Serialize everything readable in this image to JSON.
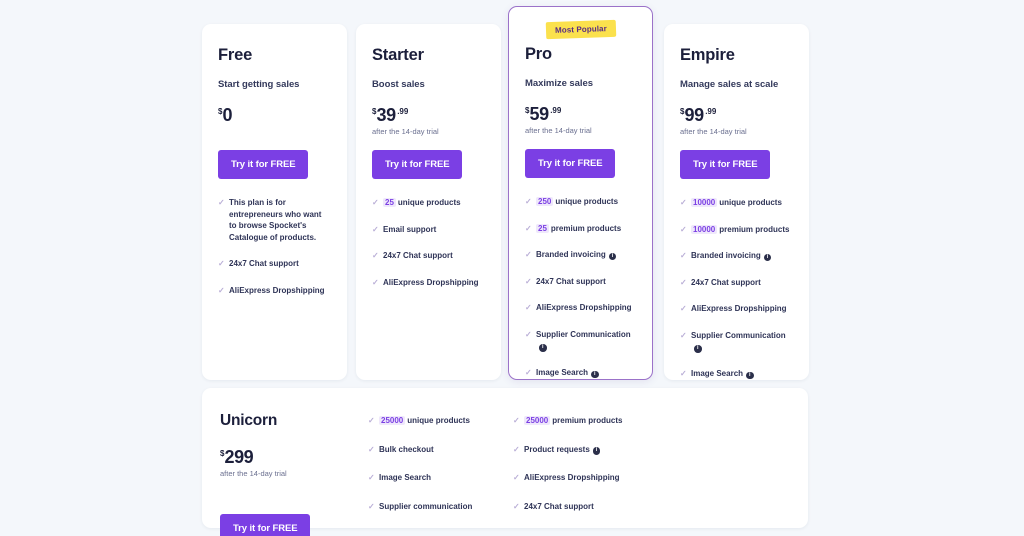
{
  "theme": {
    "page_bg": "#f4f7fb",
    "accent": "#7b3fe4",
    "badge_bg": "#fbe14d",
    "badge_text": "#5a2d82",
    "highlight_text": "#7b3fe4",
    "highlight_bg": "#efe8fb",
    "featured_border": "#9b72c9",
    "heading": "#1c1f3b",
    "check": "#b9aed6"
  },
  "cta_label": "Try it for FREE",
  "trial_note": "after the 14-day trial",
  "check_icon": "✓",
  "info_icon": "i",
  "plans": [
    {
      "name": "Free",
      "tagline": "Start getting sales",
      "currency": "$",
      "price": "0",
      "cents": "",
      "trial": "",
      "cta": "Try it for FREE",
      "featured": false,
      "badge": "",
      "features": [
        {
          "highlight": "",
          "text": "This plan is for entrepreneurs who want to browse Spocket's Catalogue of products.",
          "info": false
        },
        {
          "highlight": "",
          "text": "24x7 Chat support",
          "info": false
        },
        {
          "highlight": "",
          "text": "AliExpress Dropshipping",
          "info": false
        }
      ]
    },
    {
      "name": "Starter",
      "tagline": "Boost sales",
      "currency": "$",
      "price": "39",
      "cents": ".99",
      "trial": "after the 14-day trial",
      "cta": "Try it for FREE",
      "featured": false,
      "badge": "",
      "features": [
        {
          "highlight": "25",
          "text": "unique products",
          "info": false
        },
        {
          "highlight": "",
          "text": "Email support",
          "info": false
        },
        {
          "highlight": "",
          "text": "24x7 Chat support",
          "info": false
        },
        {
          "highlight": "",
          "text": "AliExpress Dropshipping",
          "info": false
        }
      ]
    },
    {
      "name": "Pro",
      "tagline": "Maximize sales",
      "currency": "$",
      "price": "59",
      "cents": ".99",
      "trial": "after the 14-day trial",
      "cta": "Try it for FREE",
      "featured": true,
      "badge": "Most Popular",
      "features": [
        {
          "highlight": "250",
          "text": "unique products",
          "info": false
        },
        {
          "highlight": "25",
          "text": "premium products",
          "info": false
        },
        {
          "highlight": "",
          "text": "Branded invoicing",
          "info": true
        },
        {
          "highlight": "",
          "text": "24x7 Chat support",
          "info": false
        },
        {
          "highlight": "",
          "text": "AliExpress Dropshipping",
          "info": false
        },
        {
          "highlight": "",
          "text": "Supplier Communication",
          "info": true
        },
        {
          "highlight": "",
          "text": "Image Search",
          "info": true
        }
      ]
    },
    {
      "name": "Empire",
      "tagline": "Manage sales at scale",
      "currency": "$",
      "price": "99",
      "cents": ".99",
      "trial": "after the 14-day trial",
      "cta": "Try it for FREE",
      "featured": false,
      "badge": "",
      "features": [
        {
          "highlight": "10000",
          "text": "unique products",
          "info": false
        },
        {
          "highlight": "10000",
          "text": "premium products",
          "info": false
        },
        {
          "highlight": "",
          "text": "Branded invoicing",
          "info": true
        },
        {
          "highlight": "",
          "text": "24x7 Chat support",
          "info": false
        },
        {
          "highlight": "",
          "text": "AliExpress Dropshipping",
          "info": false
        },
        {
          "highlight": "",
          "text": "Supplier Communication",
          "info": true
        },
        {
          "highlight": "",
          "text": "Image Search",
          "info": true
        }
      ]
    }
  ],
  "unicorn": {
    "name": "Unicorn",
    "currency": "$",
    "price": "299",
    "cents": "",
    "trial": "after the 14-day trial",
    "cta": "Try it for FREE",
    "column_1": [
      {
        "highlight": "25000",
        "text": "unique products",
        "info": false
      },
      {
        "highlight": "",
        "text": "Bulk checkout",
        "info": false
      },
      {
        "highlight": "",
        "text": "Image Search",
        "info": false
      },
      {
        "highlight": "",
        "text": "Supplier communication",
        "info": false
      }
    ],
    "column_2": [
      {
        "highlight": "25000",
        "text": "premium products",
        "info": false
      },
      {
        "highlight": "",
        "text": "Product requests",
        "info": true
      },
      {
        "highlight": "",
        "text": "AliExpress Dropshipping",
        "info": false
      },
      {
        "highlight": "",
        "text": "24x7 Chat support",
        "info": false
      }
    ]
  }
}
